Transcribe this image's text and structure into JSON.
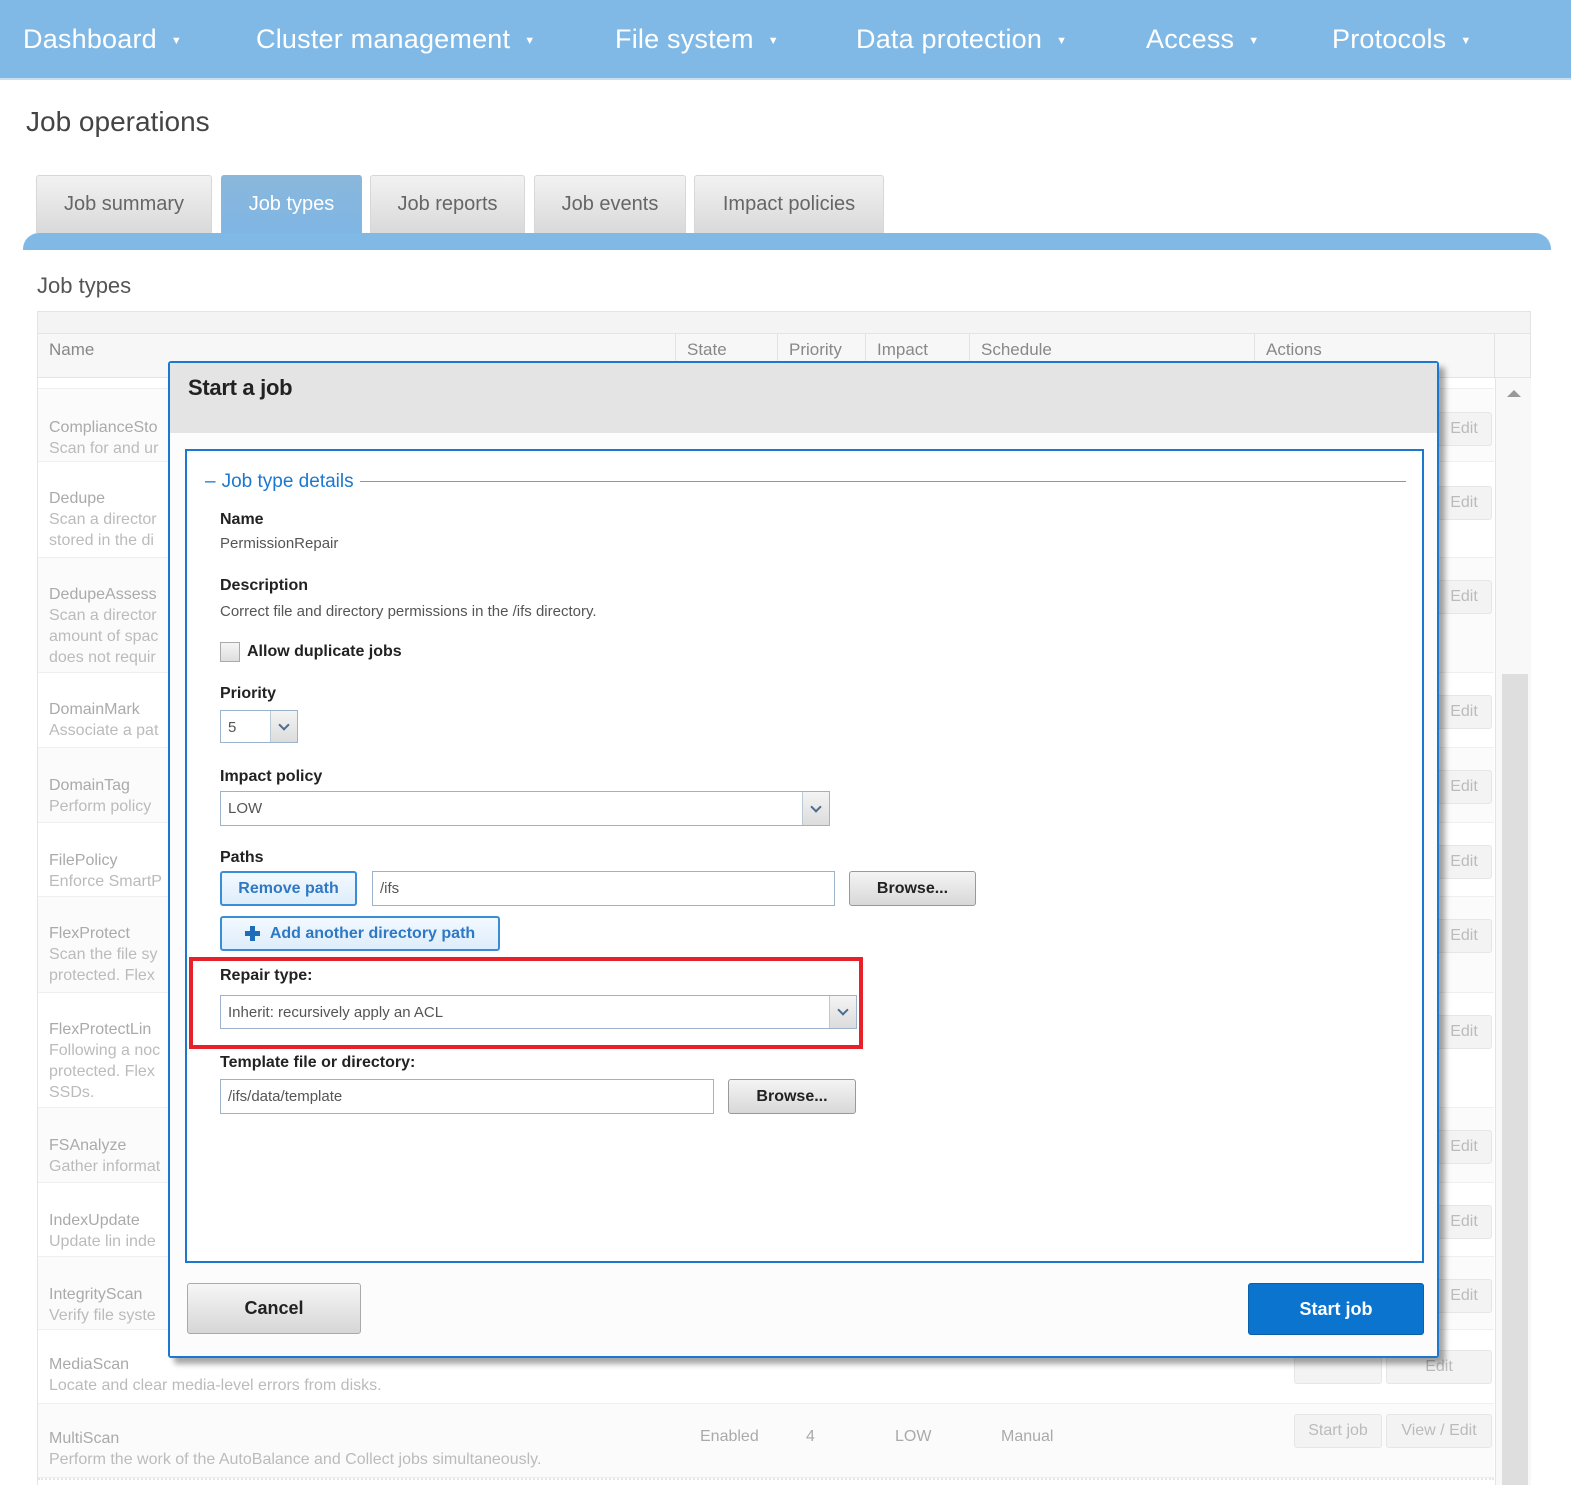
{
  "nav": {
    "items": [
      {
        "label": "Dashboard"
      },
      {
        "label": "Cluster management"
      },
      {
        "label": "File system"
      },
      {
        "label": "Data protection"
      },
      {
        "label": "Access"
      },
      {
        "label": "Protocols"
      }
    ],
    "caret": "▼"
  },
  "page": {
    "title": "Job operations",
    "section_title": "Job types"
  },
  "tabs": [
    {
      "label": "Job summary",
      "active": false
    },
    {
      "label": "Job types",
      "active": true
    },
    {
      "label": "Job reports",
      "active": false
    },
    {
      "label": "Job events",
      "active": false
    },
    {
      "label": "Impact policies",
      "active": false
    }
  ],
  "table": {
    "columns": [
      "Name",
      "State",
      "Priority",
      "Impact",
      "Schedule",
      "Actions"
    ],
    "rows": [
      {
        "name": "ComplianceSto",
        "desc": "Scan for and ur",
        "action_edit": "Edit"
      },
      {
        "name": "Dedupe",
        "desc": "Scan a director\nstored in the di",
        "action_edit": "Edit"
      },
      {
        "name": "DedupeAssess",
        "desc": "Scan a director\namount of spac\ndoes not requir",
        "action_edit": "Edit"
      },
      {
        "name": "DomainMark",
        "desc": "Associate a pat",
        "action_edit": "Edit"
      },
      {
        "name": "DomainTag",
        "desc": "Perform policy",
        "action_edit": "Edit"
      },
      {
        "name": "FilePolicy",
        "desc": "Enforce SmartP",
        "action_edit": "Edit"
      },
      {
        "name": "FlexProtect",
        "desc": "Scan the file sy\nprotected. Flex",
        "action_edit": "Edit"
      },
      {
        "name": "FlexProtectLin",
        "desc": "Following a noc\nprotected. Flex\nSSDs.",
        "action_edit": "Edit"
      },
      {
        "name": "FSAnalyze",
        "desc": "Gather informat",
        "action_edit": "Edit"
      },
      {
        "name": "IndexUpdate",
        "desc": "Update lin inde",
        "action_edit": "Edit"
      },
      {
        "name": "IntegrityScan",
        "desc": "Verify file syste",
        "action_edit": "Edit"
      },
      {
        "name": "MediaScan",
        "desc": "Locate and clear media-level errors from disks.",
        "action_edit": "Edit"
      },
      {
        "name": "MultiScan",
        "desc": "Perform the work of the AutoBalance and Collect jobs simultaneously.",
        "state": "Enabled",
        "priority": "4",
        "impact": "LOW",
        "schedule": "Manual",
        "action_start": "Start job",
        "action_view": "View / Edit"
      }
    ]
  },
  "dialog": {
    "title": "Start a job",
    "legend": "Job type details",
    "legend_toggle": "–",
    "name_label": "Name",
    "name_value": "PermissionRepair",
    "description_label": "Description",
    "description_value": "Correct file and directory permissions in the /ifs directory.",
    "allow_duplicate_label": "Allow duplicate jobs",
    "allow_duplicate_checked": false,
    "priority_label": "Priority",
    "priority_value": "5",
    "impact_label": "Impact policy",
    "impact_value": "LOW",
    "paths_label": "Paths",
    "remove_path_label": "Remove path",
    "path_value": "/ifs",
    "browse_label": "Browse...",
    "add_path_label": "Add another directory path",
    "repair_type_label": "Repair type:",
    "repair_type_value": "Inherit: recursively apply an ACL",
    "template_label": "Template file or directory:",
    "template_value": "/ifs/data/template",
    "template_browse_label": "Browse...",
    "cancel_label": "Cancel",
    "start_label": "Start job"
  },
  "colors": {
    "nav_bg": "#80b9e5",
    "accent_blue": "#1c78cf",
    "primary_button": "#0a74cf",
    "highlight_red": "#e8202a"
  }
}
